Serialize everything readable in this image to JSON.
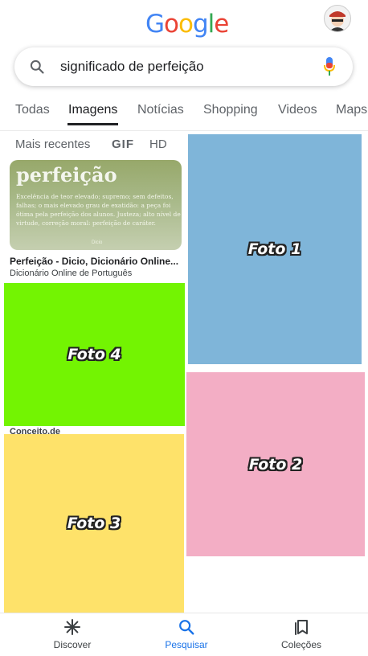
{
  "header": {
    "logo_letters": [
      {
        "char": "G",
        "color": "#4285F4"
      },
      {
        "char": "o",
        "color": "#EA4335"
      },
      {
        "char": "o",
        "color": "#FBBC05"
      },
      {
        "char": "g",
        "color": "#4285F4"
      },
      {
        "char": "l",
        "color": "#34A853"
      },
      {
        "char": "e",
        "color": "#EA4335"
      }
    ],
    "avatar_icon": "user-avatar"
  },
  "search": {
    "query": "significado de perfeição",
    "icon": "search-icon",
    "mic_icon": "mic-icon"
  },
  "tabs": [
    {
      "label": "Todas"
    },
    {
      "label": "Imagens",
      "active": true
    },
    {
      "label": "Notícias"
    },
    {
      "label": "Shopping"
    },
    {
      "label": "Videos"
    },
    {
      "label": "Maps"
    }
  ],
  "filters": [
    {
      "label": "Mais recentes"
    },
    {
      "label": "GIF"
    },
    {
      "label": "HD"
    }
  ],
  "results": {
    "card": {
      "image_word": "perfeição",
      "image_text": "Excelência de teor elevado; supremo; sem defeitos, falhas; o mais elevado grau de exatidão: a peça foi ótima pela perfeição dos alunos. Justeza; alto nível de virtude, correção moral: perfeição de caráter.",
      "image_brand": "Dicio",
      "title": "Perfeição - Dicio, Dicionário Online...",
      "source": "Dicionário Online de Português"
    },
    "photos": [
      {
        "label": "Foto 1",
        "color": "#7FB5D9"
      },
      {
        "label": "Foto 2",
        "color": "#F3AEC5"
      },
      {
        "label": "Foto 3",
        "color": "#FEE26A"
      },
      {
        "label": "Foto 4",
        "color": "#73F402"
      }
    ],
    "photo4_source": "Conceito.de"
  },
  "bottom_nav": [
    {
      "label": "Discover",
      "icon": "asterisk-icon"
    },
    {
      "label": "Pesquisar",
      "icon": "search-icon",
      "active": true
    },
    {
      "label": "Coleções",
      "icon": "bookmarks-icon"
    }
  ]
}
